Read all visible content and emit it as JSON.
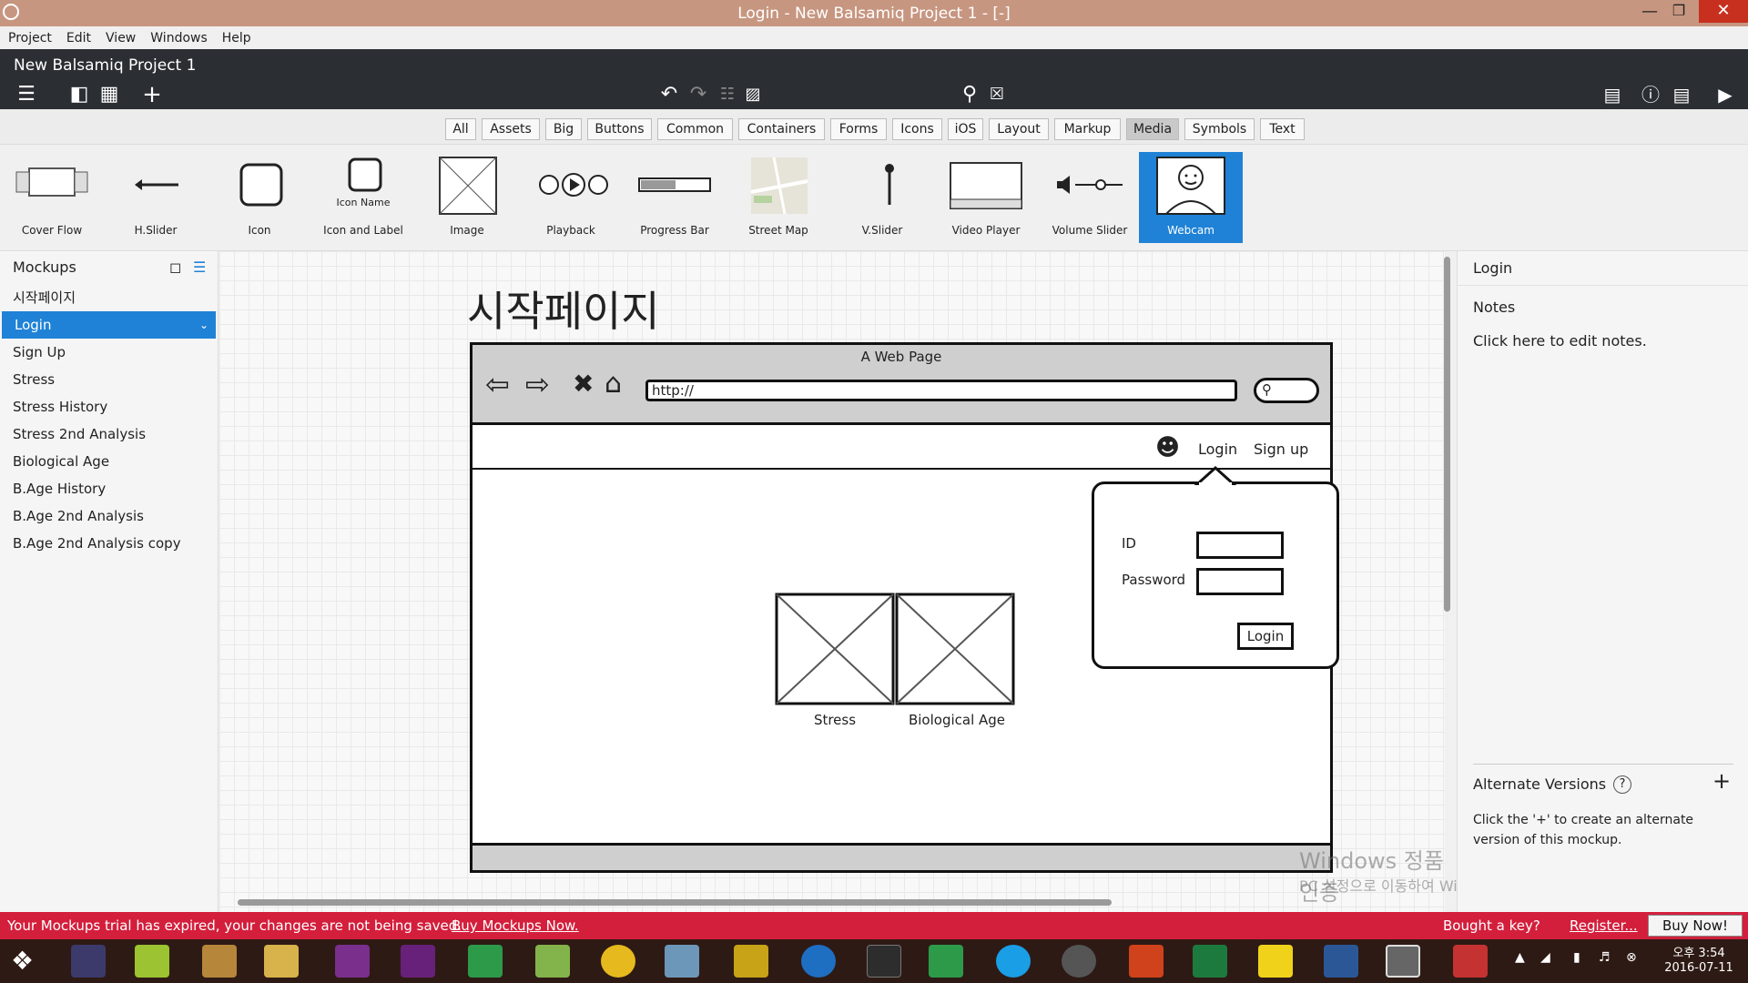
{
  "window": {
    "title": "Login - New Balsamiq Project 1 - [-]"
  },
  "menu": [
    "Project",
    "Edit",
    "View",
    "Windows",
    "Help"
  ],
  "project": {
    "name": "New Balsamiq Project 1"
  },
  "filters": [
    "All",
    "Assets",
    "Big",
    "Buttons",
    "Common",
    "Containers",
    "Forms",
    "Icons",
    "iOS",
    "Layout",
    "Markup",
    "Media",
    "Symbols",
    "Text"
  ],
  "filter_selected": "Media",
  "palette": [
    "Cover Flow",
    "H.Slider",
    "Icon",
    "Icon and Label",
    "Image",
    "Playback",
    "Progress Bar",
    "Street Map",
    "V.Slider",
    "Video Player",
    "Volume Slider",
    "Webcam"
  ],
  "palette_selected": "Webcam",
  "icon_label_sample": "Icon Name",
  "mockups": {
    "title": "Mockups",
    "items": [
      "시작페이지",
      "Login",
      "Sign Up",
      "Stress",
      "Stress History",
      "Stress 2nd Analysis",
      "Biological Age",
      "B.Age History",
      "B.Age 2nd Analysis",
      "B.Age 2nd Analysis copy"
    ],
    "selected": "Login"
  },
  "canvas": {
    "heading": "시작페이지",
    "browser_title": "A Web Page",
    "url": "http://",
    "nav_login": "Login",
    "nav_signup": "Sign up",
    "id_label": "ID",
    "password_label": "Password",
    "login_button": "Login",
    "img1_caption": "Stress",
    "img2_caption": "Biological Age"
  },
  "right": {
    "title": "Login",
    "notes_label": "Notes",
    "notes_text": "Click here to edit notes.",
    "alt_title": "Alternate Versions",
    "alt_help": "?",
    "alt_text": "Click the '+' to create an alternate version of this mockup."
  },
  "watermark": {
    "line1": "Windows 정품 인증",
    "line2": "PC 설정으로 이동하여 Windows를 정품 인증합니다."
  },
  "trial": {
    "message": "Your Mockups trial has expired, your changes are not being saved.",
    "link": "Buy Mockups Now.",
    "key_question": "Bought a key?",
    "register": "Register...",
    "buy": "Buy Now!"
  },
  "clock": {
    "ampm": "오후 3:54",
    "date": "2016-07-11"
  },
  "colors": {
    "accent": "#1f82d6",
    "trial_bar": "#d31f3c",
    "titlebar": "#c79680"
  }
}
